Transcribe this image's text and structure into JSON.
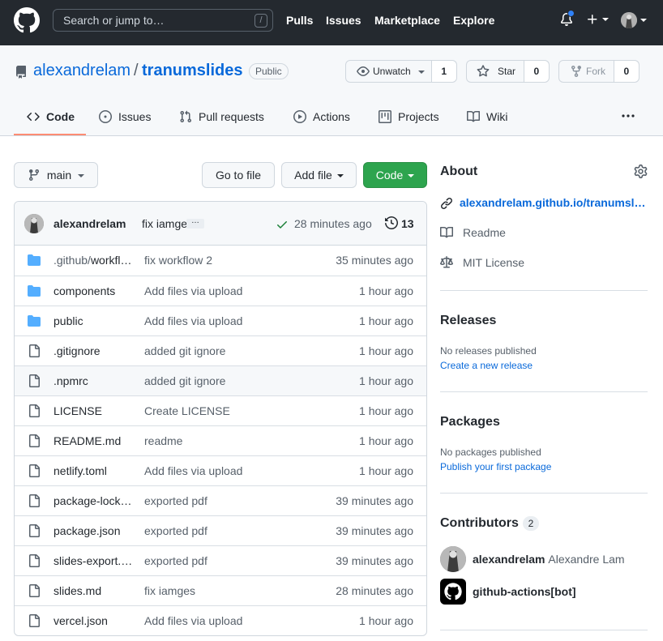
{
  "header": {
    "search_placeholder": "Search or jump to…",
    "search_shortcut": "/",
    "nav": [
      "Pulls",
      "Issues",
      "Marketplace",
      "Explore"
    ]
  },
  "repo": {
    "owner": "alexandrelam",
    "separator": "/",
    "name": "tranumslides",
    "visibility": "Public",
    "watch_label": "Unwatch",
    "watch_count": "1",
    "star_label": "Star",
    "star_count": "0",
    "fork_label": "Fork",
    "fork_count": "0"
  },
  "tabs": [
    "Code",
    "Issues",
    "Pull requests",
    "Actions",
    "Projects",
    "Wiki"
  ],
  "toolbar": {
    "branch": "main",
    "goto_file": "Go to file",
    "add_file": "Add file",
    "code": "Code"
  },
  "latest_commit": {
    "author": "alexandrelam",
    "message": "fix iamges",
    "ellipsis": "…",
    "time": "28 minutes ago",
    "count": "13"
  },
  "files": [
    {
      "type": "dir",
      "name_prefix": ".github/",
      "name": "workflows",
      "message": "fix workflow 2",
      "age": "35 minutes ago"
    },
    {
      "type": "dir",
      "name_prefix": "",
      "name": "components",
      "message": "Add files via upload",
      "age": "1 hour ago"
    },
    {
      "type": "dir",
      "name_prefix": "",
      "name": "public",
      "message": "Add files via upload",
      "age": "1 hour ago"
    },
    {
      "type": "file",
      "name_prefix": "",
      "name": ".gitignore",
      "message": "added git ignore",
      "age": "1 hour ago"
    },
    {
      "type": "file",
      "name_prefix": "",
      "name": ".npmrc",
      "message": "added git ignore",
      "age": "1 hour ago"
    },
    {
      "type": "file",
      "name_prefix": "",
      "name": "LICENSE",
      "message": "Create LICENSE",
      "age": "1 hour ago"
    },
    {
      "type": "file",
      "name_prefix": "",
      "name": "README.md",
      "message": "readme",
      "age": "1 hour ago"
    },
    {
      "type": "file",
      "name_prefix": "",
      "name": "netlify.toml",
      "message": "Add files via upload",
      "age": "1 hour ago"
    },
    {
      "type": "file",
      "name_prefix": "",
      "name": "package-lock.json",
      "message": "exported pdf",
      "age": "39 minutes ago"
    },
    {
      "type": "file",
      "name_prefix": "",
      "name": "package.json",
      "message": "exported pdf",
      "age": "39 minutes ago"
    },
    {
      "type": "file",
      "name_prefix": "",
      "name": "slides-export.pdf",
      "message": "exported pdf",
      "age": "39 minutes ago"
    },
    {
      "type": "file",
      "name_prefix": "",
      "name": "slides.md",
      "message": "fix iamges",
      "age": "28 minutes ago"
    },
    {
      "type": "file",
      "name_prefix": "",
      "name": "vercel.json",
      "message": "Add files via upload",
      "age": "1 hour ago"
    }
  ],
  "sidebar": {
    "about_title": "About",
    "website": "alexandrelam.github.io/tranumslides",
    "readme": "Readme",
    "license": "MIT License",
    "releases_title": "Releases",
    "releases_empty": "No releases published",
    "releases_link": "Create a new release",
    "packages_title": "Packages",
    "packages_empty": "No packages published",
    "packages_link": "Publish your first package",
    "contributors_title": "Contributors",
    "contributors_count": "2",
    "contributors": [
      {
        "login": "alexandrelam",
        "name": "Alexandre Lam"
      },
      {
        "login": "github-actions[bot]",
        "name": ""
      }
    ]
  },
  "colors": {
    "header_bg": "#24292f",
    "link": "#0969da",
    "primary_button": "#2da44e",
    "folder": "#54aeff",
    "tab_underline": "#fd8c73"
  }
}
